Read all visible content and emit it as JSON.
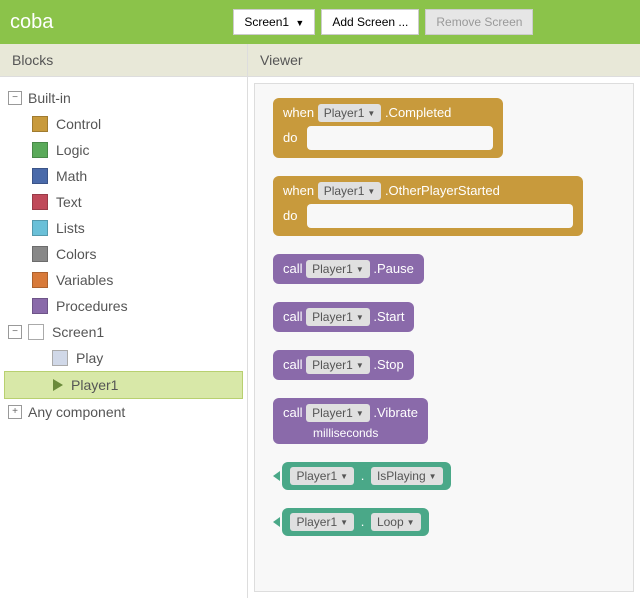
{
  "header": {
    "title": "coba",
    "screen_btn": "Screen1",
    "add_btn": "Add Screen ...",
    "remove_btn": "Remove Screen"
  },
  "sidebar": {
    "title": "Blocks",
    "builtin_label": "Built-in",
    "categories": [
      {
        "label": "Control",
        "color": "#c89a3c"
      },
      {
        "label": "Logic",
        "color": "#5aaa5a"
      },
      {
        "label": "Math",
        "color": "#4a6aaa"
      },
      {
        "label": "Text",
        "color": "#c04a5a"
      },
      {
        "label": "Lists",
        "color": "#6ac0d8"
      },
      {
        "label": "Colors",
        "color": "#888888"
      },
      {
        "label": "Variables",
        "color": "#d87a3a"
      },
      {
        "label": "Procedures",
        "color": "#8a6aaa"
      }
    ],
    "screen_label": "Screen1",
    "components": [
      {
        "label": "Play",
        "icon": "screen"
      },
      {
        "label": "Player1",
        "icon": "play"
      }
    ],
    "any_label": "Any component"
  },
  "viewer": {
    "title": "Viewer",
    "block1": {
      "kw": "when",
      "target": "Player1",
      "event": ".Completed",
      "do": "do"
    },
    "block2": {
      "kw": "when",
      "target": "Player1",
      "event": ".OtherPlayerStarted",
      "do": "do"
    },
    "call1": {
      "kw": "call",
      "target": "Player1",
      "method": ".Pause"
    },
    "call2": {
      "kw": "call",
      "target": "Player1",
      "method": ".Start"
    },
    "call3": {
      "kw": "call",
      "target": "Player1",
      "method": ".Stop"
    },
    "call4": {
      "kw": "call",
      "target": "Player1",
      "method": ".Vibrate",
      "arg": "milliseconds"
    },
    "get1": {
      "target": "Player1",
      "prop": "IsPlaying"
    },
    "get2": {
      "target": "Player1",
      "prop": "Loop"
    }
  }
}
